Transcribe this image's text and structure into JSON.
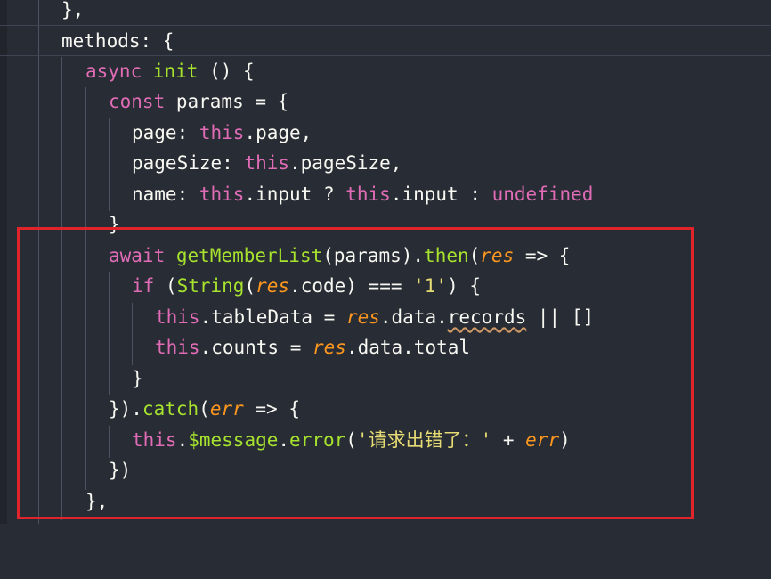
{
  "code": {
    "l1": {
      "closing": "},"
    },
    "l2": {
      "methods": "methods",
      "colon": ": {"
    },
    "l3": {
      "async": "async",
      "init": "init",
      "rest": " () {"
    },
    "l4": {
      "const": "const",
      "rest": " params = {"
    },
    "l5": {
      "key": "page: ",
      "this": "this",
      "rest": ".page,"
    },
    "l6": {
      "key": "pageSize: ",
      "this": "this",
      "rest": ".pageSize,"
    },
    "l7": {
      "key": "name: ",
      "this1": "this",
      "mid": ".input ? ",
      "this2": "this",
      "mid2": ".input : ",
      "undef": "undefined"
    },
    "l8": {
      "closing": "}"
    },
    "l9": {
      "await": "await",
      "fn": "getMemberList",
      "args": "(params).",
      "then": "then",
      "open": "(",
      "res": "res",
      "arrow": " => {"
    },
    "l10": {
      "if": "if",
      "open": " (",
      "string": "String",
      "open2": "(",
      "res": "res",
      "rest": ".code) === ",
      "one": "'1'",
      "end": ") {"
    },
    "l11": {
      "this": "this",
      "mid": ".tableData = ",
      "res": "res",
      "data": ".data.",
      "records": "records",
      "end": " || []"
    },
    "l12": {
      "this": "this",
      "mid": ".counts = ",
      "res": "res",
      "end": ".data.total"
    },
    "l13": {
      "closing": "}"
    },
    "l14": {
      "open": "}).",
      "catch": "catch",
      "paren": "(",
      "err": "err",
      "arrow": " => {"
    },
    "l15": {
      "this": "this",
      "dot": ".",
      "msg": "$message",
      "dot2": ".",
      "error": "error",
      "open": "(",
      "str": "'请求出错了：'",
      "plus": " + ",
      "err": "err",
      "close": ")"
    },
    "l16": {
      "closing": "})"
    },
    "l17": {
      "closing": "},"
    }
  },
  "colors": {
    "background": "#282c34",
    "keyword": "#e06cb6",
    "function": "#a6e22e",
    "string": "#e6db74",
    "parameter": "#fd971f",
    "highlight_border": "#e0242b"
  }
}
